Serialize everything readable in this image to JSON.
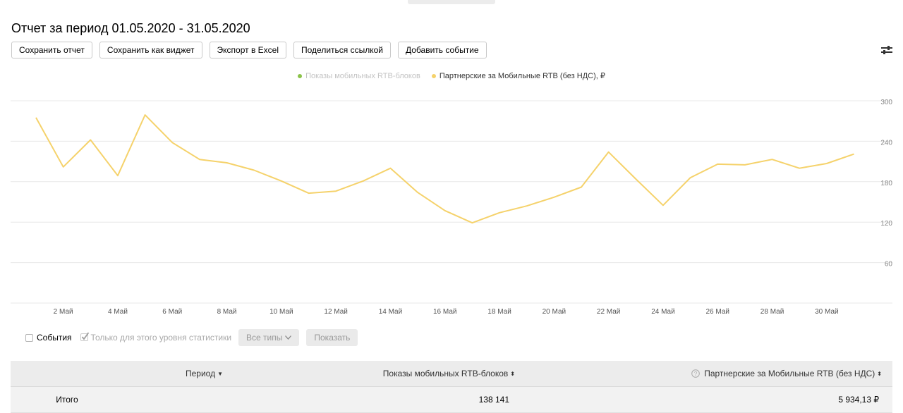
{
  "report": {
    "title": "Отчет за период 01.05.2020 - 31.05.2020"
  },
  "toolbar": {
    "save_report": "Сохранить отчет",
    "save_widget": "Сохранить как виджет",
    "export_excel": "Экспорт в Excel",
    "share_link": "Поделиться ссылкой",
    "add_event": "Добавить событие"
  },
  "colors": {
    "series_impressions": "#8bc34a",
    "series_partner": "#f5d26b",
    "gridline": "#e8e8e8",
    "axis_text": "#555555"
  },
  "legend": {
    "impressions": "Показы мобильных RTB-блоков",
    "partner": "Партнерские за Мобильные RTB (без НДС), ₽"
  },
  "chart_data": {
    "type": "line",
    "x_tick_labels": [
      "2 Май",
      "4 Май",
      "6 Май",
      "8 Май",
      "10 Май",
      "12 Май",
      "14 Май",
      "16 Май",
      "18 Май",
      "20 Май",
      "22 Май",
      "24 Май",
      "26 Май",
      "28 Май",
      "30 Май"
    ],
    "y_tick_labels": [
      "300",
      "240",
      "180",
      "120",
      "60"
    ],
    "ylim": [
      0,
      300
    ],
    "grid": true,
    "legend_position": "top-center",
    "y_axis_position": "right",
    "series": [
      {
        "name": "Показы мобильных RTB-блоков",
        "visible": false,
        "values": []
      },
      {
        "name": "Партнерские за Мобильные RTB (без НДС), ₽",
        "visible": true,
        "days": [
          1,
          2,
          3,
          4,
          5,
          6,
          7,
          8,
          9,
          10,
          11,
          12,
          13,
          14,
          15,
          16,
          17,
          18,
          19,
          20,
          21,
          22,
          23,
          24,
          25,
          26,
          27,
          28,
          29,
          30,
          31
        ],
        "values": [
          275,
          202,
          242,
          189,
          279,
          238,
          213,
          208,
          197,
          181,
          163,
          166,
          181,
          200,
          164,
          137,
          119,
          134,
          144,
          157,
          172,
          224,
          184,
          145,
          186,
          206,
          205,
          213,
          200,
          207,
          221
        ]
      }
    ]
  },
  "filters": {
    "events_label": "События",
    "only_level_label": "Только для этого уровня статистики",
    "all_types": "Все типы",
    "show": "Показать"
  },
  "table": {
    "headers": {
      "period": "Период",
      "impressions": "Показы мобильных RTB-блоков",
      "partner": "Партнерские за Мобильные RTB (без НДС)"
    },
    "total": {
      "label": "Итого",
      "impressions": "138 141",
      "partner": "5 934,13 ₽"
    }
  }
}
